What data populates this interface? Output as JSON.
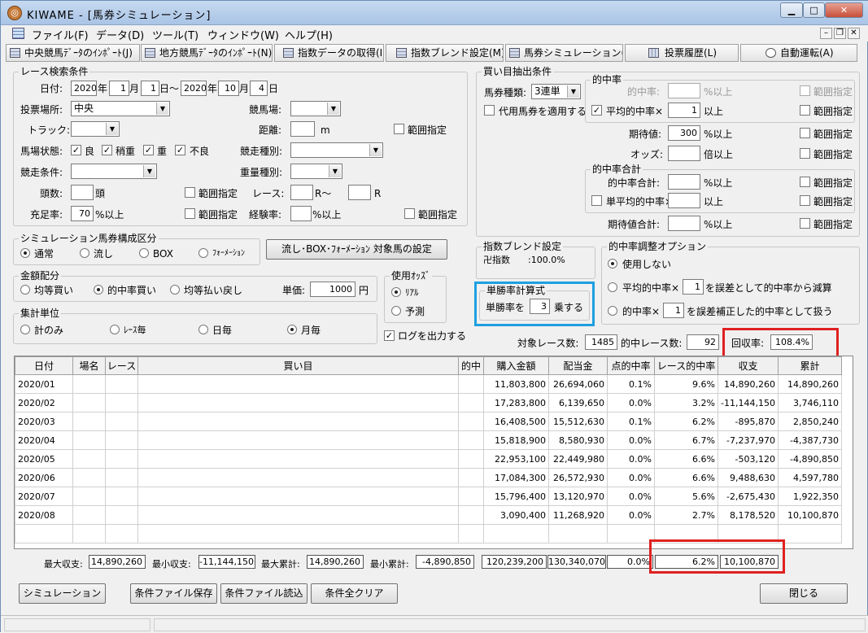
{
  "window": {
    "app": "KIWAME",
    "doc": "[馬券シミュレーション]",
    "minimize": "▁",
    "maximize": "□",
    "close": "✕"
  },
  "menu": [
    "ファイル(F)",
    "データ(D)",
    "ツール(T)",
    "ウィンドウ(W)",
    "ヘルプ(H)"
  ],
  "mdi": {
    "minimize": "–",
    "restore": "❐",
    "close": "✕"
  },
  "toolbar": [
    "中央競馬ﾃﾞｰﾀのｲﾝﾎﾟｰﾄ(J)",
    "地方競馬ﾃﾞｰﾀのｲﾝﾎﾟｰﾄ(N)",
    "指数データの取得(I)",
    "指数ブレンド設定(M)",
    "馬券シミュレーション(B)",
    "投票履歴(L)",
    "自動運転(A)"
  ],
  "race_search": {
    "title": "レース検索条件",
    "date_label": "日付:",
    "from_year": "2020",
    "year": "年",
    "from_month": "1",
    "month": "月",
    "from_day": "1",
    "day_tilde": "日〜",
    "to_year": "2020",
    "to_month": "10",
    "to_day": "4",
    "day": "日",
    "venue_label": "投票場所:",
    "venue_value": "中央",
    "course_label": "競馬場:",
    "track_label": "トラック:",
    "distance_label": "距離:",
    "distance_unit": "m",
    "range": "範囲指定",
    "condition_label": "馬場状態:",
    "cond": [
      "良",
      "稍重",
      "重",
      "不良"
    ],
    "race_type_label": "競走種別:",
    "race_cond_label": "競走条件:",
    "weight_label": "重量種別:",
    "heads_label": "頭数:",
    "heads_unit": "頭",
    "race_label": "レース:",
    "race_r1": "R〜",
    "race_r2": "R",
    "fill_label": "充足率:",
    "fill_value": "70",
    "fill_unit": "%以上",
    "exp_label": "経験率:",
    "exp_unit": "%以上"
  },
  "bet_extract": {
    "title": "買い目抽出条件",
    "type_label": "馬券種類:",
    "type_value": "3連単",
    "substitute": "代用馬券を適用する",
    "hit_title": "的中率",
    "hit_rate_label": "的中率:",
    "hit_rate_unit": "%以上",
    "avg_hit_label": "平均的中率×",
    "avg_hit_value": "1",
    "avg_hit_unit": "以上",
    "exp_label": "期待値:",
    "exp_value": "300",
    "exp_unit": "%以上",
    "odds_label": "オッズ:",
    "odds_unit": "倍以上",
    "hitsum_title": "的中率合計",
    "hitsum_label": "的中率合計:",
    "hitsum_unit": "%以上",
    "single_avg_label": "単平均的中率×",
    "single_avg_unit": "以上",
    "expsum_label": "期待値合計:",
    "expsum_unit": "%以上",
    "range": "範囲指定"
  },
  "sim_type": {
    "title": "シミュレーション馬券構成区分",
    "options": [
      "通常",
      "流し",
      "BOX",
      "ﾌｫｰﾒｰｼｮﾝ"
    ],
    "selected": 0,
    "set_button": "流し･BOX･ﾌｫｰﾒｰｼｮﾝ 対象馬の設定"
  },
  "blend": {
    "title": "指数ブレンド設定",
    "index_label": "卍指数",
    "index_value": ":100.0%"
  },
  "money": {
    "title": "金額配分",
    "options": [
      "均等買い",
      "的中率買い",
      "均等払い戻し"
    ],
    "selected": 1,
    "unit_label": "単価:",
    "unit_value": "1000",
    "unit": "円"
  },
  "odds_use": {
    "title": "使用ｵｯｽﾞ",
    "options": [
      "ﾘｱﾙ",
      "予測"
    ],
    "selected": 0
  },
  "win_calc": {
    "title": "単勝率計算式",
    "prefix": "単勝率を",
    "value": "3",
    "suffix": "乗する"
  },
  "hit_adjust": {
    "title": "的中率調整オプション",
    "opt1": "使用しない",
    "opt2_pre": "平均的中率×",
    "opt2_val": "1",
    "opt2_post": "を誤差として的中率から減算",
    "opt3_pre": "的中率×",
    "opt3_val": "1",
    "opt3_post": "を誤差補正した的中率として扱う"
  },
  "aggregate": {
    "title": "集計単位",
    "options": [
      "計のみ",
      "ﾚｰｽ毎",
      "日毎",
      "月毎"
    ],
    "selected": 3
  },
  "log_output": "ログを出力する",
  "stats": {
    "target_label": "対象レース数:",
    "target_value": "1485",
    "hit_label": "的中レース数:",
    "hit_value": "92",
    "return_label": "回収率:",
    "return_value": "108.4%"
  },
  "table": {
    "headers": [
      "日付",
      "場名",
      "レース",
      "買い目",
      "的中",
      "購入金額",
      "配当金",
      "点的中率",
      "レース的中率",
      "収支",
      "累計"
    ],
    "rows": [
      [
        "2020/01",
        "",
        "",
        "",
        "",
        "11,803,800",
        "26,694,060",
        "0.1%",
        "9.6%",
        "14,890,260",
        "14,890,260"
      ],
      [
        "2020/02",
        "",
        "",
        "",
        "",
        "17,283,800",
        "6,139,650",
        "0.0%",
        "3.2%",
        "-11,144,150",
        "3,746,110"
      ],
      [
        "2020/03",
        "",
        "",
        "",
        "",
        "16,408,500",
        "15,512,630",
        "0.1%",
        "6.2%",
        "-895,870",
        "2,850,240"
      ],
      [
        "2020/04",
        "",
        "",
        "",
        "",
        "15,818,900",
        "8,580,930",
        "0.0%",
        "6.7%",
        "-7,237,970",
        "-4,387,730"
      ],
      [
        "2020/05",
        "",
        "",
        "",
        "",
        "22,953,100",
        "22,449,980",
        "0.0%",
        "6.6%",
        "-503,120",
        "-4,890,850"
      ],
      [
        "2020/06",
        "",
        "",
        "",
        "",
        "17,084,300",
        "26,572,930",
        "0.0%",
        "6.6%",
        "9,488,630",
        "4,597,780"
      ],
      [
        "2020/07",
        "",
        "",
        "",
        "",
        "15,796,400",
        "13,120,970",
        "0.0%",
        "5.6%",
        "-2,675,430",
        "1,922,350"
      ],
      [
        "2020/08",
        "",
        "",
        "",
        "",
        "3,090,400",
        "11,268,920",
        "0.0%",
        "2.7%",
        "8,178,520",
        "10,100,870"
      ]
    ]
  },
  "summary": {
    "max_label": "最大収支:",
    "max_value": "14,890,260",
    "min_label": "最小収支:",
    "min_value": "-11,144,150",
    "maxc_label": "最大累計:",
    "maxc_value": "14,890,260",
    "minc_label": "最小累計:",
    "minc_value": "-4,890,850",
    "purchase": "120,239,200",
    "payout": "130,340,070",
    "point_hit": "0.0%",
    "race_hit": "6.2%",
    "total": "10,100,870"
  },
  "buttons": {
    "simulate": "シミュレーション",
    "save": "条件ファイル保存",
    "load": "条件ファイル読込",
    "clear": "条件全クリア",
    "close": "閉じる"
  },
  "colors": {
    "highlight_red": "#e02020",
    "highlight_blue": "#1ea0e0"
  }
}
